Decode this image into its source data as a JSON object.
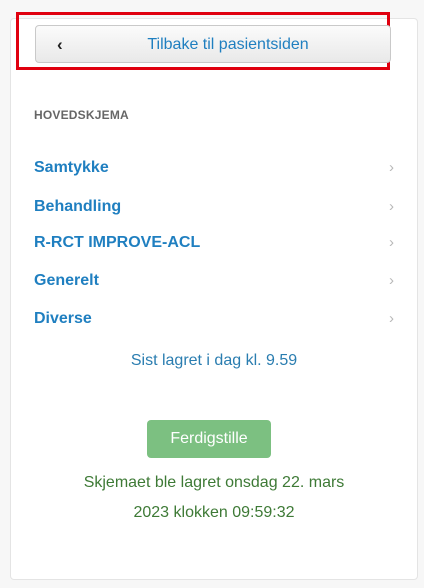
{
  "back_button": {
    "chevron": "‹",
    "label": "Tilbake til pasientsiden"
  },
  "section": {
    "heading": "HOVEDSKJEMA",
    "items": [
      {
        "label": "Samtykke",
        "chevron": "›"
      },
      {
        "label": "Behandling",
        "chevron": "›"
      },
      {
        "label": "R-RCT IMPROVE-ACL",
        "chevron": "›"
      },
      {
        "label": "Generelt",
        "chevron": "›"
      },
      {
        "label": "Diverse",
        "chevron": "›"
      }
    ]
  },
  "status": {
    "last_saved": "Sist lagret i dag kl. 9.59"
  },
  "complete": {
    "label": "Ferdigstille"
  },
  "save_message": {
    "line1": "Skjemaet ble lagret onsdag 22. mars",
    "line2": "2023 klokken 09:59:32"
  },
  "colors": {
    "link": "#1f7fc0",
    "highlight_border": "#e0000f",
    "complete_button": "#7cc081",
    "success_text": "#3e7a36"
  }
}
